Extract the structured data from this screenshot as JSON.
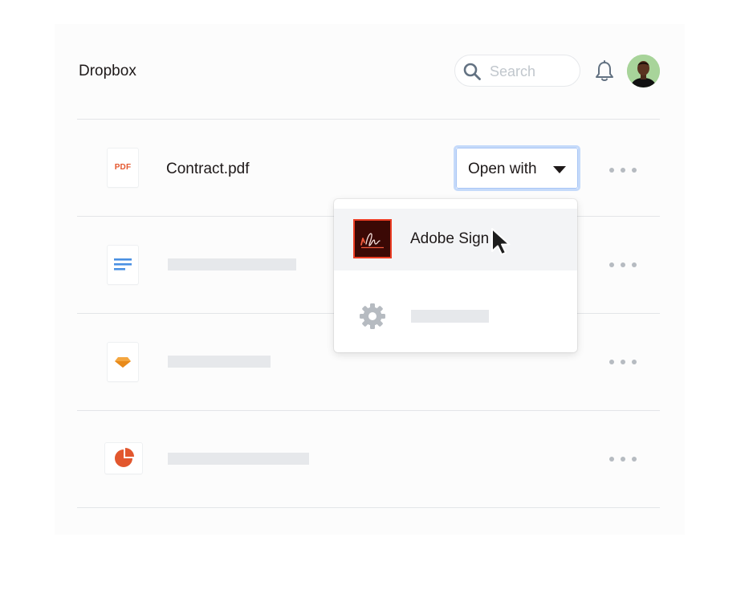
{
  "header": {
    "app_title": "Dropbox",
    "search_placeholder": "Search"
  },
  "icons": {
    "search": "search-icon",
    "notifications": "bell-icon",
    "avatar": "user-avatar",
    "more": "more-options-icon",
    "caret": "caret-down-icon",
    "settings": "gear-icon",
    "cursor": "mouse-pointer-icon"
  },
  "files": [
    {
      "name": "Contract.pdf",
      "type_label": "PDF",
      "icon": "pdf-file-icon"
    },
    {
      "name": "",
      "icon": "document-file-icon"
    },
    {
      "name": "",
      "icon": "sketch-file-icon"
    },
    {
      "name": "",
      "icon": "presentation-file-icon"
    }
  ],
  "open_with": {
    "label": "Open with",
    "menu_items": [
      {
        "label": "Adobe Sign",
        "icon": "adobe-sign-icon",
        "hovered": true
      },
      {
        "label": "",
        "icon": "gear-icon"
      }
    ]
  },
  "colors": {
    "pdf_accent": "#e4572e",
    "doc_accent": "#4a90e2",
    "sketch_accent": "#f4a640",
    "chart_accent": "#e2572e",
    "focus_ring": "#c5dafa",
    "adobe_red": "#ec3d24",
    "adobe_dark": "#3b0905"
  }
}
